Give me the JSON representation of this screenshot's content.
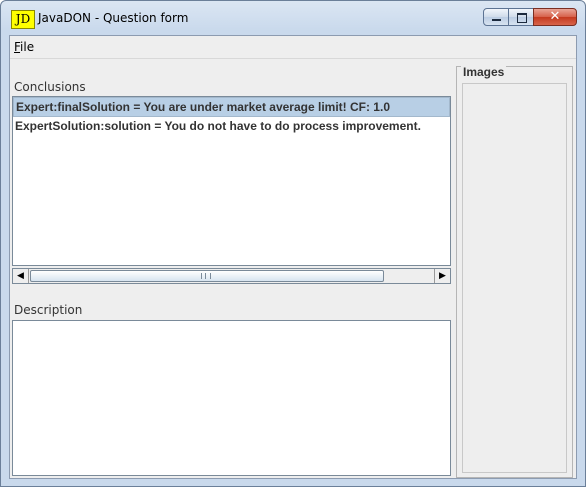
{
  "window": {
    "icon_text": "JD",
    "title": "JavaDON - Question form"
  },
  "menubar": {
    "file_mnemonic": "F",
    "file_rest": "ile"
  },
  "conclusions": {
    "label": "Conclusions",
    "items": [
      "Expert:finalSolution = You are under market average limit! CF: 1.0",
      "ExpertSolution:solution = You do not have to do process improvement."
    ],
    "selected_index": 0
  },
  "description": {
    "label": "Description",
    "value": ""
  },
  "images": {
    "label": "Images"
  }
}
